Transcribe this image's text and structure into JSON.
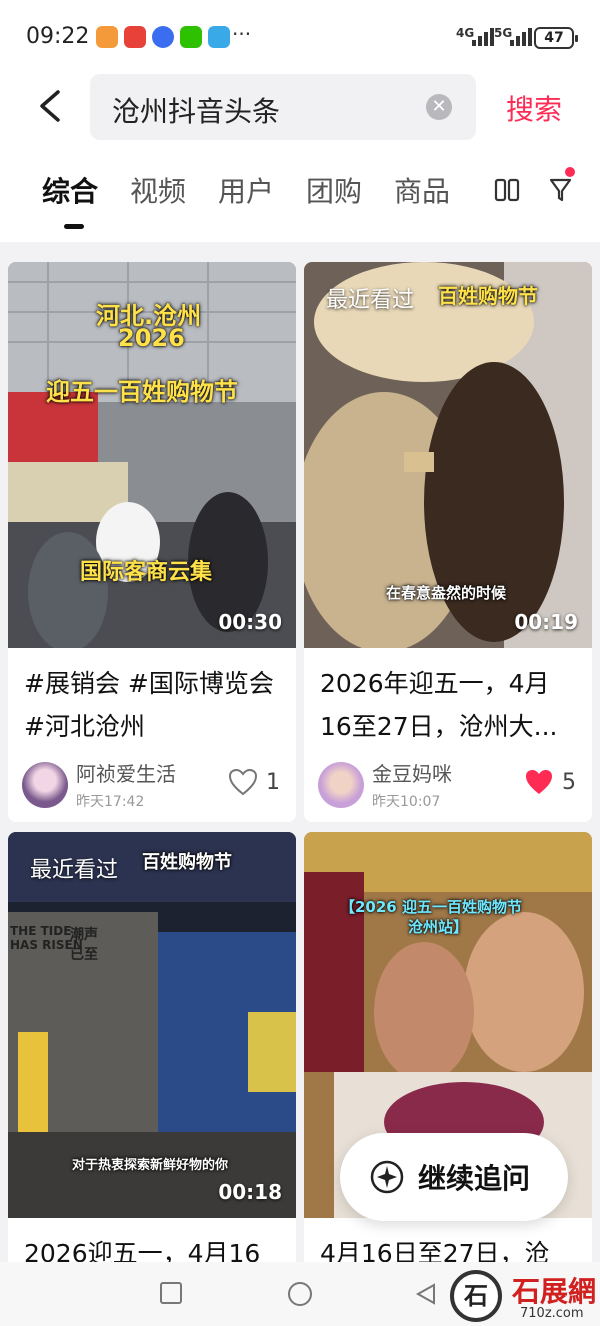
{
  "status_bar": {
    "time": "09:22",
    "more": "···",
    "network_1": "4G",
    "network_2": "5G",
    "battery": "47"
  },
  "search": {
    "query": "沧州抖音头条",
    "button": "搜索"
  },
  "tabs": [
    {
      "label": "综合",
      "active": true
    },
    {
      "label": "视频",
      "active": false
    },
    {
      "label": "用户",
      "active": false
    },
    {
      "label": "团购",
      "active": false
    },
    {
      "label": "商品",
      "active": false
    }
  ],
  "cards": [
    {
      "overlay_lines": [
        "河北.沧州",
        "2026",
        "迎五一百姓购物节"
      ],
      "overlay_bottom": "国际客商云集",
      "duration": "00:30",
      "title": "#展销会 #国际博览会#河北沧州",
      "author": "阿祯爱生活",
      "time": "昨天17:42",
      "likes": "1",
      "liked": false
    },
    {
      "recent": "最近看过",
      "overlay_top": "百姓购物节",
      "caption": "在春意盎然的时候",
      "duration": "00:19",
      "title": "2026年迎五一，4月16至27日，沧州大...",
      "author": "金豆妈咪",
      "time": "昨天10:07",
      "likes": "5",
      "liked": true
    },
    {
      "recent": "最近看过",
      "overlay_top": "百姓购物节",
      "sign_1": "THE TIDE",
      "sign_2": "HAS RISEN",
      "sign_3": "潮声已至",
      "caption": "对于热衷探索新鲜好物的你",
      "duration": "00:18",
      "title": "2026迎五一，4月16"
    },
    {
      "overlay_top": "【2026 迎五一百姓购物节",
      "overlay_top_2": "沧州站】",
      "title": "4月16日至27日，沧"
    }
  ],
  "followup": {
    "label": "继续追问",
    "icon_text": "AI"
  },
  "watermark": {
    "glyph": "石",
    "text": "石展網",
    "url": "710z.com"
  },
  "colors": {
    "accent": "#fe2c55",
    "like_red": "#fe2c55"
  }
}
